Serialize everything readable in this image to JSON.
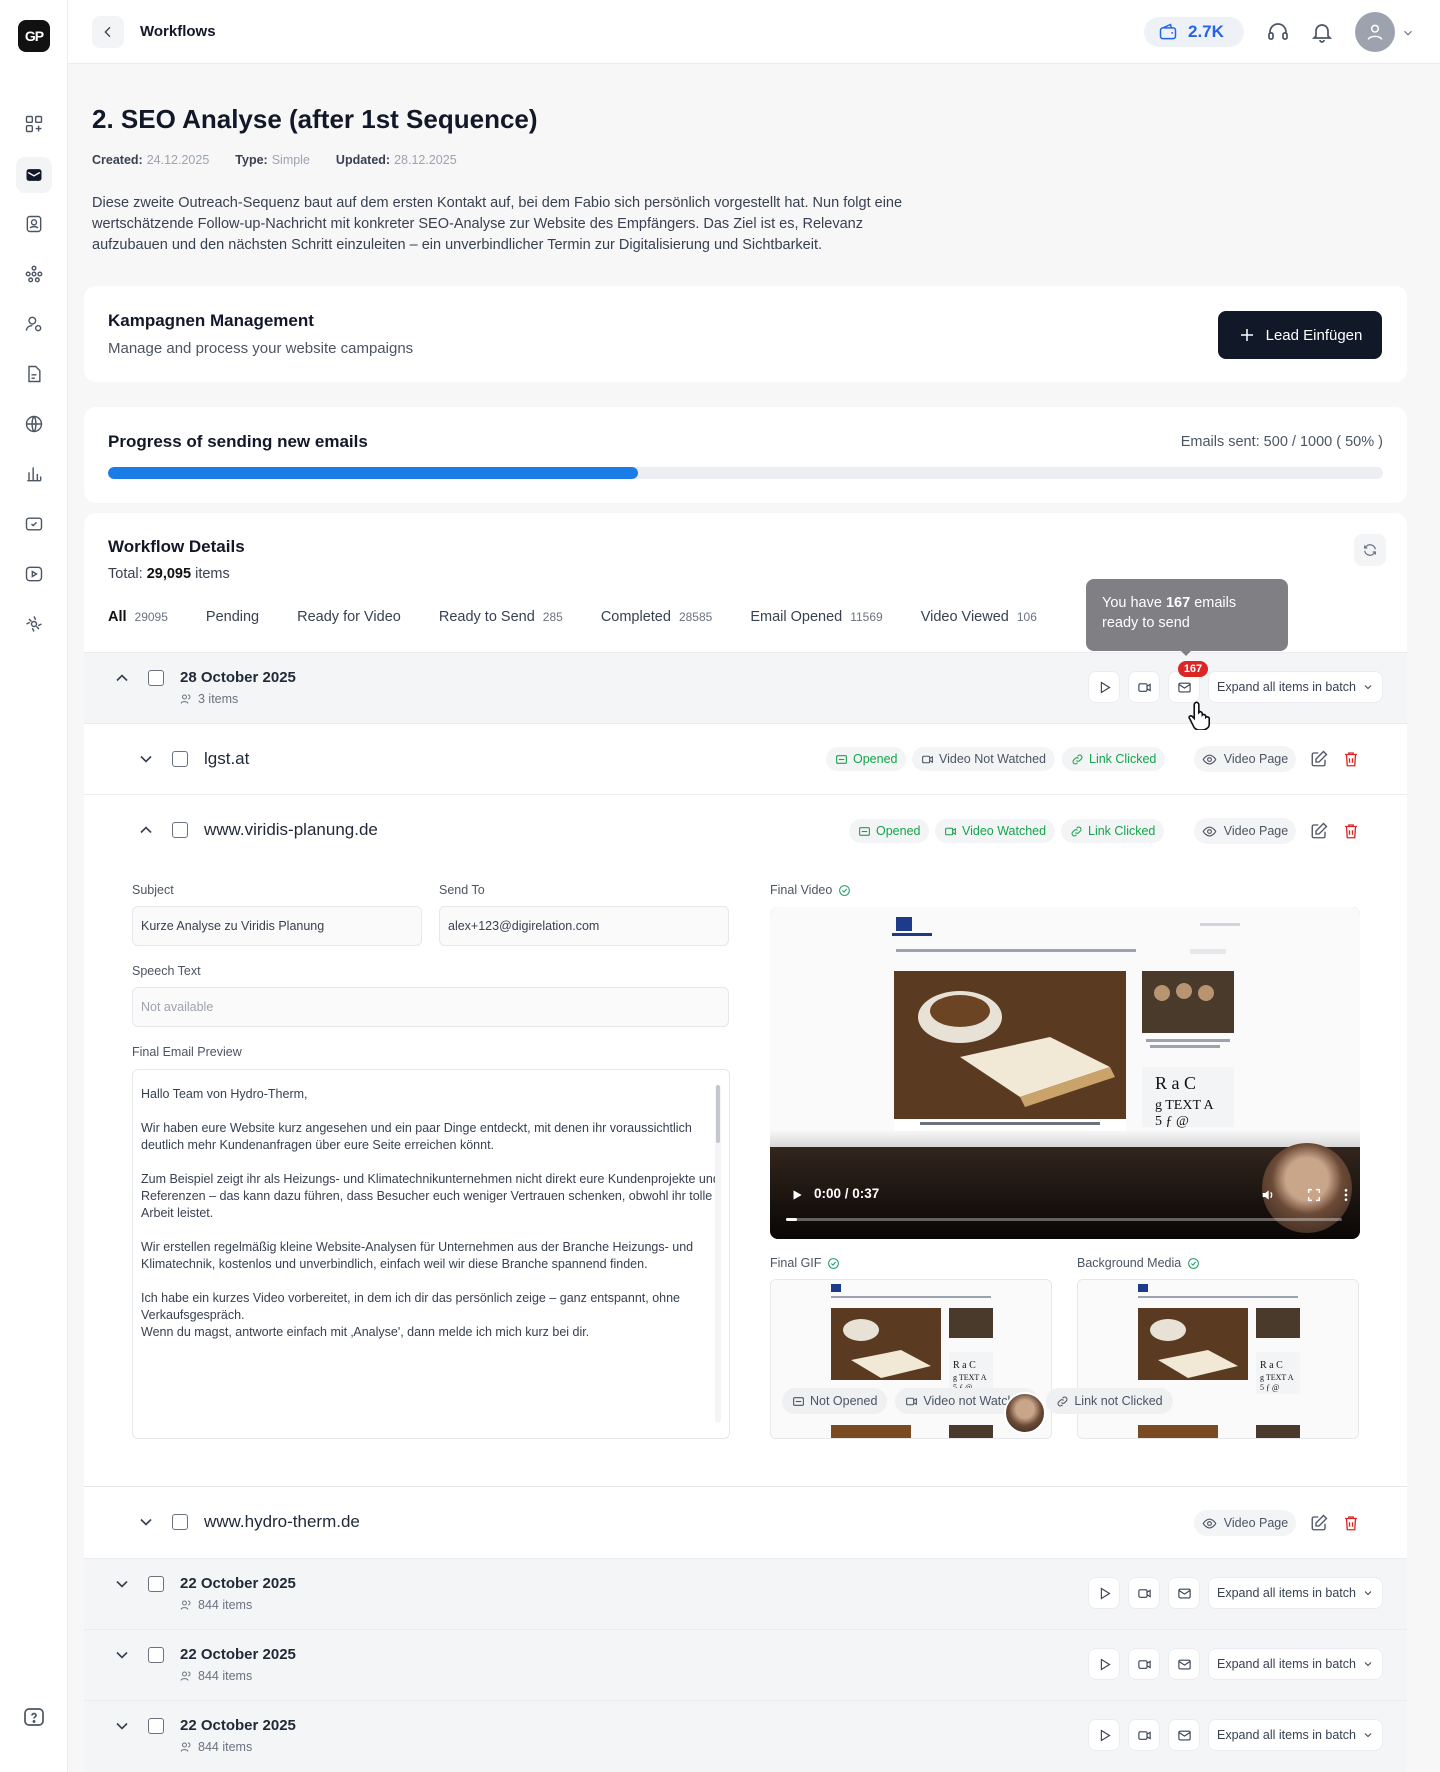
{
  "app": {
    "logo": "GP"
  },
  "sidebar": {
    "items": [
      "dashboard-icon",
      "inbox-icon",
      "contacts-icon",
      "network-icon",
      "user-settings-icon",
      "document-icon",
      "globe-icon",
      "analytics-icon",
      "mail-check-icon",
      "video-icon",
      "integrations-icon"
    ],
    "help": "help-icon"
  },
  "topbar": {
    "title": "Workflows",
    "credits": "2.7K"
  },
  "page": {
    "title": "2. SEO Analyse (after 1st Sequence)",
    "created_label": "Created:",
    "created": "24.12.2025",
    "type_label": "Type:",
    "type": "Simple",
    "updated_label": "Updated:",
    "updated": "28.12.2025",
    "description": "Diese zweite Outreach-Sequenz baut auf dem ersten Kontakt auf, bei dem Fabio sich persönlich vorgestellt hat. Nun folgt eine wertschätzende Follow-up-Nachricht mit konkreter SEO-Analyse zur Website des Empfängers. Das Ziel ist es, Relevanz aufzubauen und den nächsten Schritt einzuleiten – ein unverbindlicher Termin zur Digitalisierung und Sichtbarkeit."
  },
  "campaign": {
    "title": "Kampagnen Management",
    "subtitle": "Manage and process your website campaigns",
    "button": "Lead Einfügen"
  },
  "progress": {
    "title": "Progress of sending new emails",
    "stat": "Emails sent: 500 / 1000 ( 50% )",
    "fraction": 0.5
  },
  "details": {
    "title": "Workflow Details",
    "total_label": "Total:",
    "total": "29,095",
    "total_suffix": "items",
    "tabs": [
      {
        "label": "All",
        "count": "29095"
      },
      {
        "label": "Pending",
        "count": ""
      },
      {
        "label": "Ready for Video",
        "count": ""
      },
      {
        "label": "Ready to Send",
        "count": "285"
      },
      {
        "label": "Completed",
        "count": "28585"
      },
      {
        "label": "Email Opened",
        "count": "11569"
      },
      {
        "label": "Video Viewed",
        "count": "106"
      }
    ]
  },
  "tooltip": {
    "pre": "You have",
    "count": "167",
    "post": "emails ready to send",
    "badge": "167"
  },
  "batches": [
    {
      "date": "28 October 2025",
      "items": "3 items",
      "expand": "Expand all items in batch"
    },
    {
      "date": "22 October 2025",
      "items": "844 items",
      "expand": "Expand all items in batch"
    },
    {
      "date": "22 October 2025",
      "items": "844 items",
      "expand": "Expand all items in batch"
    },
    {
      "date": "22 October 2025",
      "items": "844 items",
      "expand": "Expand all items in batch"
    }
  ],
  "leads": [
    {
      "domain": "lgst.at",
      "opened": "Opened",
      "video": "Video Not Watched",
      "link": "Link Clicked",
      "video_page": "Video Page"
    },
    {
      "domain": "www.viridis-planung.de",
      "opened": "Opened",
      "video": "Video Watched",
      "link": "Link Clicked",
      "video_page": "Video Page"
    },
    {
      "domain": "www.hydro-therm.de",
      "video_page": "Video Page"
    }
  ],
  "expanded": {
    "subject_label": "Subject",
    "subject": "Kurze Analyse zu Viridis Planung",
    "sendto_label": "Send To",
    "sendto": "alex+123@digirelation.com",
    "speech_label": "Speech Text",
    "speech": "Not available",
    "preview_label": "Final Email Preview",
    "email_body": "Hallo Team von Hydro-Therm,\n\nWir haben eure Website kurz angesehen und ein paar Dinge entdeckt, mit denen ihr voraussichtlich deutlich mehr Kundenanfragen über eure Seite erreichen könnt.\n\nZum Beispiel zeigt ihr als Heizungs- und Klimatechnikunternehmen nicht direkt eure Kundenprojekte und Referenzen – das kann dazu führen, dass Besucher euch weniger Vertrauen schenken, obwohl ihr tolle Arbeit leistet.\n\nWir erstellen regelmäßig kleine Website-Analysen für Unternehmen aus der Branche Heizungs- und Klimatechnik, kostenlos und unverbindlich, einfach weil wir diese Branche spannend finden.\n\nIch habe ein kurzes Video vorbereitet, in dem ich dir das persönlich zeige – ganz entspannt, ohne Verkaufsgespräch.\nWenn du magst, antworte einfach mit ‚Analyse', dann melde ich mich kurz bei dir.",
    "final_video_label": "Final Video",
    "video_time": "0:00 / 0:37",
    "video_progress": 0.02,
    "final_gif_label": "Final GIF",
    "bg_media_label": "Background Media",
    "status_bar": {
      "opened": "Not Opened",
      "video": "Video not Watched",
      "link": "Link not Clicked"
    }
  },
  "colors": {
    "accent": "#1c7ce6",
    "success": "#16a34a",
    "danger": "#dc2626",
    "dark": "#111827"
  }
}
